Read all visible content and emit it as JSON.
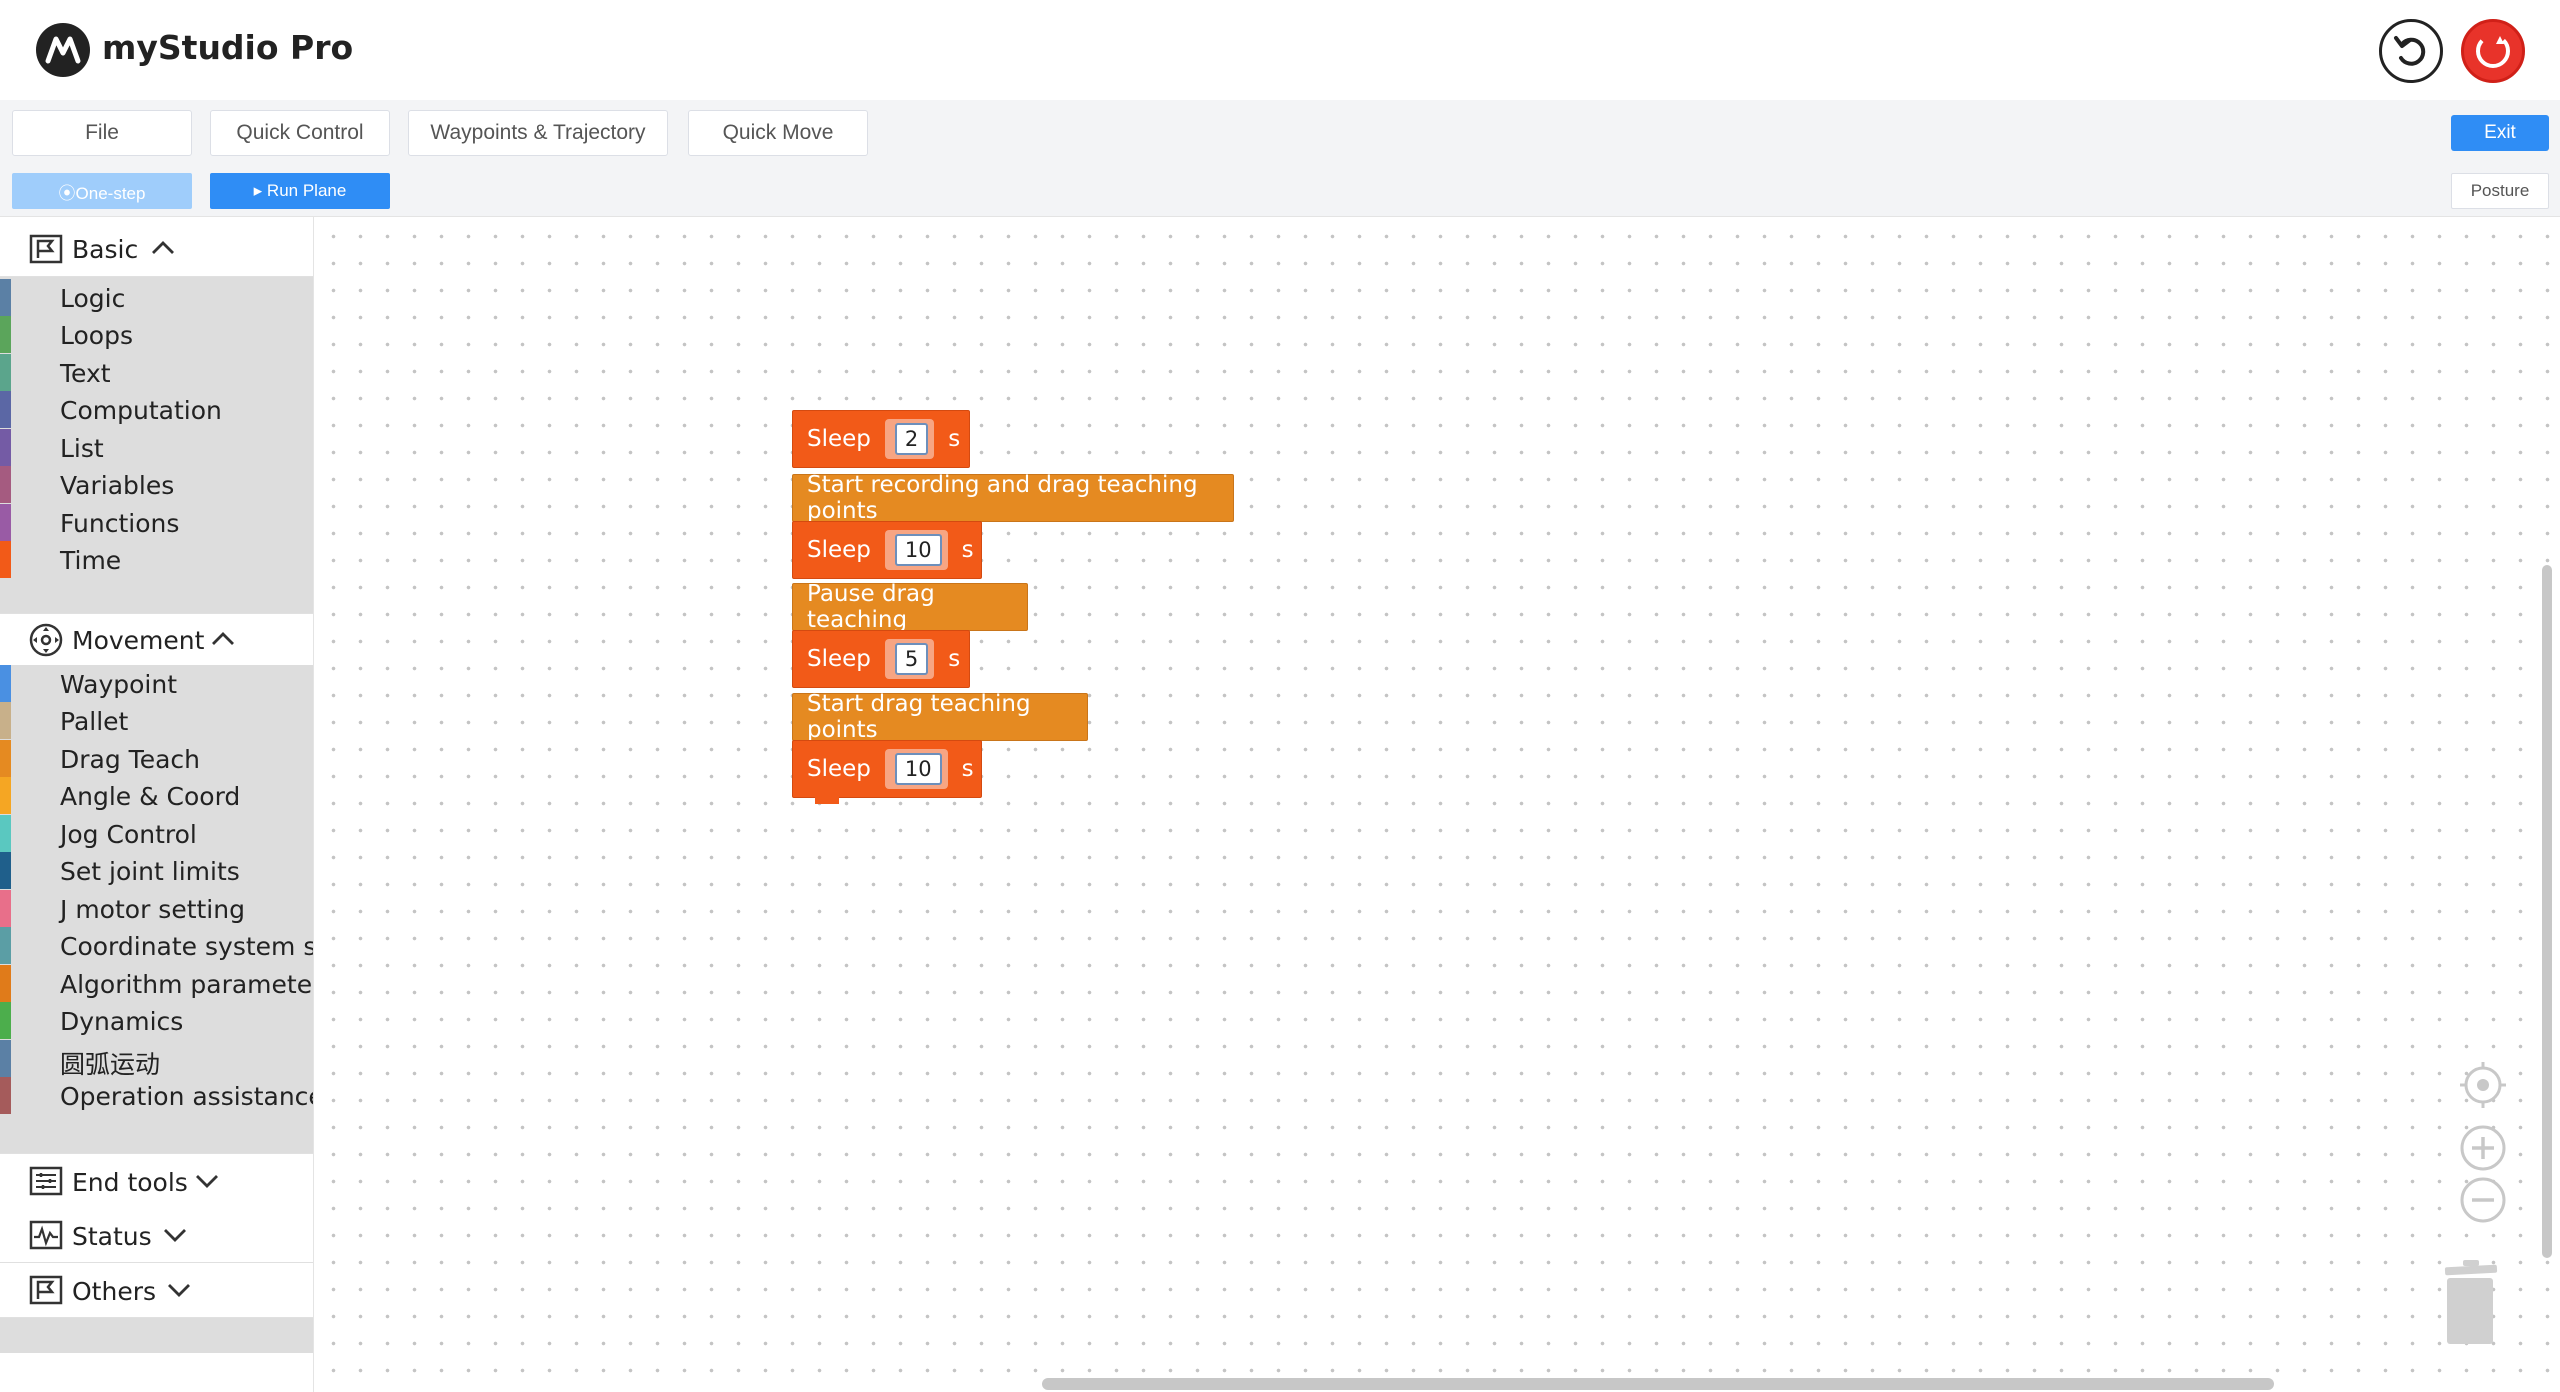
{
  "app": {
    "title": "myStudio Pro"
  },
  "header": {
    "undo_icon": "undo-icon",
    "power_icon": "power-icon"
  },
  "toolbar": {
    "menus": [
      {
        "label": "File"
      },
      {
        "label": "Quick Control"
      },
      {
        "label": "Waypoints & Trajectory"
      },
      {
        "label": "Quick Move"
      }
    ],
    "exit_label": "Exit",
    "one_step_label": "⦿One-step",
    "run_plane_label": "▸ Run Plane",
    "posture_label": "Posture"
  },
  "sidebar": {
    "basic": {
      "label": "Basic",
      "expanded": true,
      "items": [
        {
          "label": "Logic",
          "color": "#5b80a5"
        },
        {
          "label": "Loops",
          "color": "#5ba55b"
        },
        {
          "label": "Text",
          "color": "#5ba58c"
        },
        {
          "label": "Computation",
          "color": "#5b67a5"
        },
        {
          "label": "List",
          "color": "#745ba5"
        },
        {
          "label": "Variables",
          "color": "#a55b80"
        },
        {
          "label": "Functions",
          "color": "#995ba5"
        },
        {
          "label": "Time",
          "color": "#f25a18"
        }
      ]
    },
    "movement": {
      "label": "Movement",
      "expanded": true,
      "items": [
        {
          "label": "Waypoint",
          "color": "#4a90e2"
        },
        {
          "label": "Pallet",
          "color": "#c8b08a"
        },
        {
          "label": "Drag Teach",
          "color": "#e58a21"
        },
        {
          "label": "Angle & Coord",
          "color": "#f5a623"
        },
        {
          "label": "Jog Control",
          "color": "#5ac8c0"
        },
        {
          "label": "Set joint limits",
          "color": "#1f5f8b"
        },
        {
          "label": "J motor setting",
          "color": "#e86f8a"
        },
        {
          "label": "Coordinate system sett",
          "color": "#5b9ea5"
        },
        {
          "label": "Algorithm parameters",
          "color": "#e07b1a"
        },
        {
          "label": "Dynamics",
          "color": "#4cae4c"
        },
        {
          "label": "圆弧运动",
          "color": "#5b80a5"
        },
        {
          "label": "Operation assistance",
          "color": "#a55b5b"
        }
      ]
    },
    "end_tools": {
      "label": "End tools",
      "expanded": false
    },
    "status": {
      "label": "Status",
      "expanded": false
    },
    "others": {
      "label": "Others",
      "expanded": false
    }
  },
  "workspace": {
    "blocks": [
      {
        "type": "sleep",
        "label": "Sleep",
        "value": "2",
        "unit": "s"
      },
      {
        "type": "drag",
        "label": "Start recording and drag teaching points"
      },
      {
        "type": "sleep",
        "label": "Sleep",
        "value": "10",
        "unit": "s"
      },
      {
        "type": "drag",
        "label": "Pause drag teaching"
      },
      {
        "type": "sleep",
        "label": "Sleep",
        "value": "5",
        "unit": "s"
      },
      {
        "type": "drag",
        "label": "Start drag teaching points"
      },
      {
        "type": "sleep",
        "label": "Sleep",
        "value": "10",
        "unit": "s"
      }
    ]
  }
}
